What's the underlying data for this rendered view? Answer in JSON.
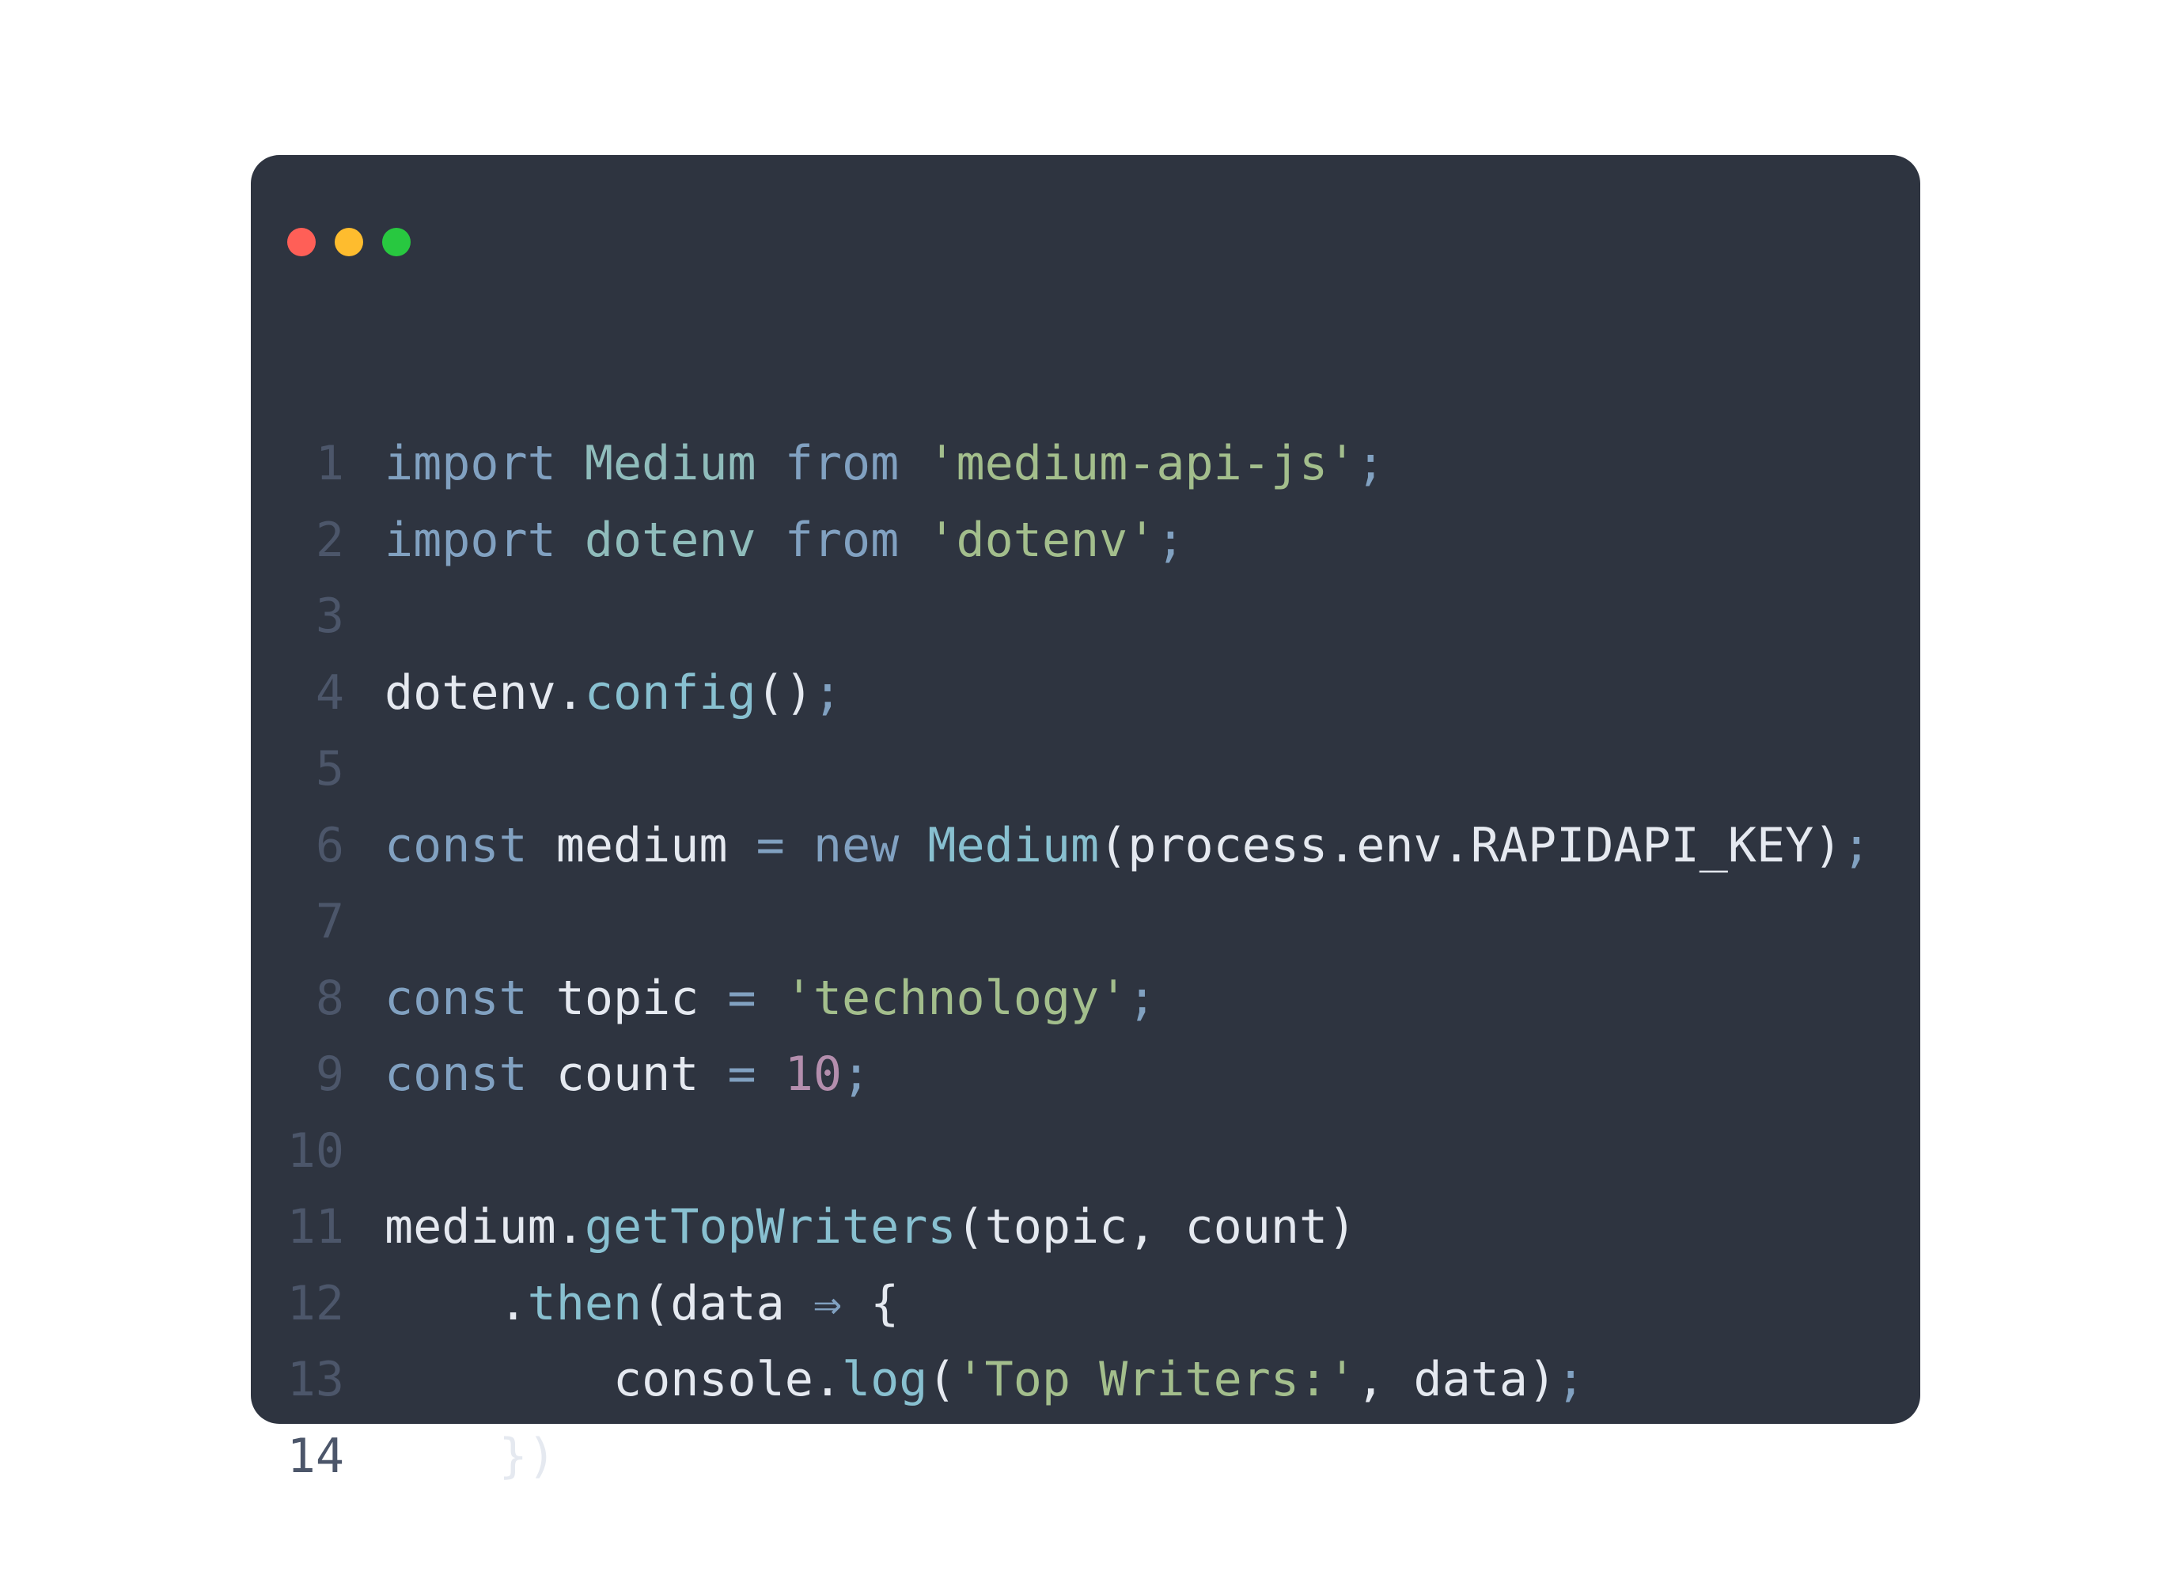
{
  "window": {
    "controls": {
      "close_color": "#ff5f57",
      "minimize_color": "#febc2e",
      "maximize_color": "#28c840"
    },
    "background_color": "#2e3440"
  },
  "code": {
    "language": "javascript",
    "lines": [
      {
        "n": "1",
        "tokens": [
          {
            "t": "import",
            "k": "kw"
          },
          {
            "t": " ",
            "k": "plain"
          },
          {
            "t": "Medium",
            "k": "cls"
          },
          {
            "t": " ",
            "k": "plain"
          },
          {
            "t": "from",
            "k": "kw"
          },
          {
            "t": " ",
            "k": "plain"
          },
          {
            "t": "'medium-api-js'",
            "k": "str"
          },
          {
            "t": ";",
            "k": "pun"
          }
        ]
      },
      {
        "n": "2",
        "tokens": [
          {
            "t": "import",
            "k": "kw"
          },
          {
            "t": " ",
            "k": "plain"
          },
          {
            "t": "dotenv",
            "k": "cls"
          },
          {
            "t": " ",
            "k": "plain"
          },
          {
            "t": "from",
            "k": "kw"
          },
          {
            "t": " ",
            "k": "plain"
          },
          {
            "t": "'dotenv'",
            "k": "str"
          },
          {
            "t": ";",
            "k": "pun"
          }
        ]
      },
      {
        "n": "3",
        "tokens": []
      },
      {
        "n": "4",
        "tokens": [
          {
            "t": "dotenv",
            "k": "plain"
          },
          {
            "t": ".",
            "k": "plain"
          },
          {
            "t": "config",
            "k": "fn"
          },
          {
            "t": "()",
            "k": "plain"
          },
          {
            "t": ";",
            "k": "pun"
          }
        ]
      },
      {
        "n": "5",
        "tokens": []
      },
      {
        "n": "6",
        "tokens": [
          {
            "t": "const",
            "k": "kw"
          },
          {
            "t": " medium ",
            "k": "plain"
          },
          {
            "t": "=",
            "k": "pun"
          },
          {
            "t": " ",
            "k": "plain"
          },
          {
            "t": "new",
            "k": "kw"
          },
          {
            "t": " ",
            "k": "plain"
          },
          {
            "t": "Medium",
            "k": "fn"
          },
          {
            "t": "(process.env.RAPIDAPI_KEY)",
            "k": "plain"
          },
          {
            "t": ";",
            "k": "pun"
          }
        ]
      },
      {
        "n": "7",
        "tokens": []
      },
      {
        "n": "8",
        "tokens": [
          {
            "t": "const",
            "k": "kw"
          },
          {
            "t": " topic ",
            "k": "plain"
          },
          {
            "t": "=",
            "k": "pun"
          },
          {
            "t": " ",
            "k": "plain"
          },
          {
            "t": "'technology'",
            "k": "str"
          },
          {
            "t": ";",
            "k": "pun"
          }
        ]
      },
      {
        "n": "9",
        "tokens": [
          {
            "t": "const",
            "k": "kw"
          },
          {
            "t": " count ",
            "k": "plain"
          },
          {
            "t": "=",
            "k": "pun"
          },
          {
            "t": " ",
            "k": "plain"
          },
          {
            "t": "10",
            "k": "num"
          },
          {
            "t": ";",
            "k": "pun"
          }
        ]
      },
      {
        "n": "10",
        "tokens": []
      },
      {
        "n": "11",
        "tokens": [
          {
            "t": "medium",
            "k": "plain"
          },
          {
            "t": ".",
            "k": "plain"
          },
          {
            "t": "getTopWriters",
            "k": "fn"
          },
          {
            "t": "(topic, count)",
            "k": "plain"
          }
        ]
      },
      {
        "n": "12",
        "tokens": [
          {
            "t": "    .",
            "k": "plain"
          },
          {
            "t": "then",
            "k": "fn"
          },
          {
            "t": "(data ",
            "k": "plain"
          },
          {
            "t": "⇒",
            "k": "pun"
          },
          {
            "t": " {",
            "k": "plain"
          }
        ]
      },
      {
        "n": "13",
        "tokens": [
          {
            "t": "        console",
            "k": "plain"
          },
          {
            "t": ".",
            "k": "plain"
          },
          {
            "t": "log",
            "k": "fn"
          },
          {
            "t": "(",
            "k": "plain"
          },
          {
            "t": "'Top Writers:'",
            "k": "str"
          },
          {
            "t": ", data)",
            "k": "plain"
          },
          {
            "t": ";",
            "k": "pun"
          }
        ]
      },
      {
        "n": "14",
        "tokens": [
          {
            "t": "    })",
            "k": "plain"
          }
        ]
      }
    ]
  }
}
